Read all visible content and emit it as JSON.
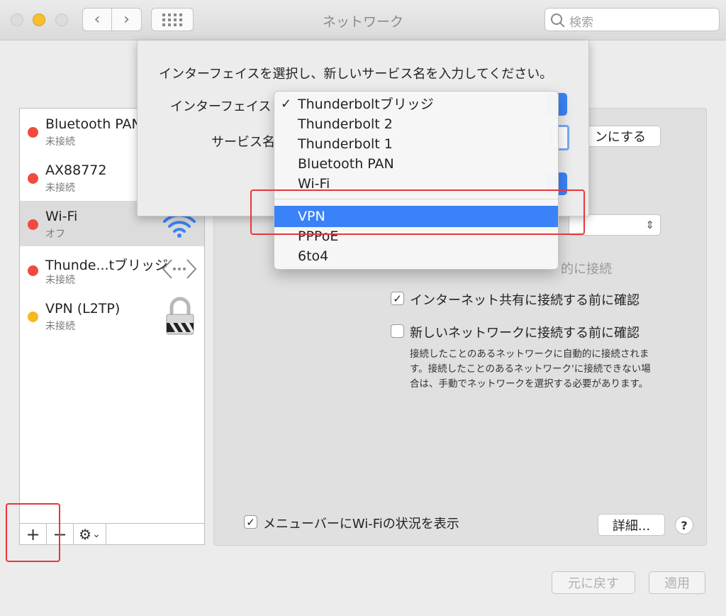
{
  "window": {
    "title": "ネットワーク"
  },
  "search": {
    "placeholder": "検索"
  },
  "services": [
    {
      "name": "Bluetooth PAN",
      "status": "未接続",
      "dot": "#f14a3f"
    },
    {
      "name": "AX88772",
      "status": "未接続",
      "dot": "#f14a3f"
    },
    {
      "name": "Wi-Fi",
      "status": "オフ",
      "dot": "#f14a3f",
      "selected": true
    },
    {
      "name": "Thunde...tブリッジ",
      "status": "未接続",
      "dot": "#f14a3f"
    },
    {
      "name": "VPN (L2TP)",
      "status": "未接続",
      "dot": "#f5b920"
    }
  ],
  "list_toolbar": {
    "add": "+",
    "remove": "−",
    "gear": "⚙",
    "gear_caret": "⌄"
  },
  "sheet": {
    "prompt": "インターフェイスを選択し、新しいサービス名を入力してください。",
    "interface_label": "インターフェイス",
    "service_name_label": "サービス名"
  },
  "menu": {
    "group1": [
      "Thunderboltブリッジ",
      "Thunderbolt 2",
      "Thunderbolt 1",
      "Bluetooth PAN",
      "Wi-Fi"
    ],
    "group2": [
      "VPN",
      "PPPoE",
      "6to4"
    ],
    "checked": "Thunderboltブリッジ",
    "highlighted": "VPN"
  },
  "right": {
    "wifi_on_button": "ンにする",
    "auto_join_partial": "的に接続",
    "confirm_sharing": "インターネット共有に接続する前に確認",
    "confirm_new_network": "新しいネットワークに接続する前に確認",
    "description": "接続したことのあるネットワークに自動的に接続されます。接続したことのあるネットワーク'に接続できない場合は、手動でネットワークを選択する必要があります。",
    "show_menubar": "メニューバーにWi-Fiの状況を表示",
    "advanced_button": "詳細...",
    "help": "?"
  },
  "footer": {
    "revert": "元に戻す",
    "apply": "適用"
  },
  "colors": {
    "accent": "#3a82f7",
    "annotation": "#e8363a"
  }
}
